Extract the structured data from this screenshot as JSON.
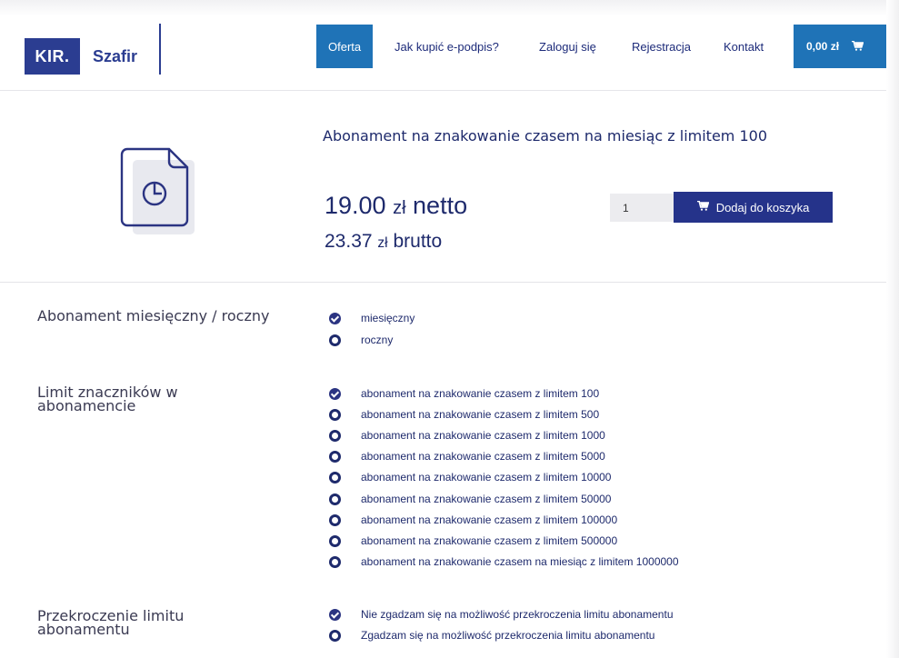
{
  "brand": {
    "logo_box": "KIR.",
    "logo_name": "Szafir"
  },
  "nav": {
    "items": [
      {
        "label": "Oferta",
        "active": true
      },
      {
        "label": "Jak kupić e-podpis?",
        "active": false
      },
      {
        "label": "Zaloguj się",
        "active": false
      },
      {
        "label": "Rejestracja",
        "active": false
      },
      {
        "label": "Kontakt",
        "active": false
      }
    ],
    "cart_total": "0,00 zł",
    "cart_icon": "shopping-cart-icon"
  },
  "product": {
    "title": "Abonament na znakowanie czasem na miesiąc z limitem 100",
    "icon": "document-clock-icon",
    "price_netto_value": "19.00",
    "price_netto_unit": "zł",
    "price_netto_label": "netto",
    "price_brutto_value": "23.37",
    "price_brutto_unit": "zł",
    "price_brutto_label": "brutto",
    "quantity": "1",
    "add_to_cart_label": "Dodaj do koszyka"
  },
  "groups": [
    {
      "label": "Abonament miesięczny / roczny",
      "options": [
        {
          "label": "miesięczny",
          "selected": true
        },
        {
          "label": "roczny",
          "selected": false
        }
      ]
    },
    {
      "label": "Limit znaczników w abonamencie",
      "options": [
        {
          "label": "abonament na znakowanie czasem z limitem 100",
          "selected": true
        },
        {
          "label": "abonament na znakowanie czasem z limitem 500",
          "selected": false
        },
        {
          "label": "abonament na znakowanie czasem z limitem 1000",
          "selected": false
        },
        {
          "label": "abonament na znakowanie czasem z limitem 5000",
          "selected": false
        },
        {
          "label": "abonament na znakowanie czasem z limitem 10000",
          "selected": false
        },
        {
          "label": "abonament na znakowanie czasem z limitem 50000",
          "selected": false
        },
        {
          "label": "abonament na znakowanie czasem z limitem 100000",
          "selected": false
        },
        {
          "label": "abonament na znakowanie czasem z limitem 500000",
          "selected": false
        },
        {
          "label": "abonament na znakowanie czasem na miesiąc z limitem 1000000",
          "selected": false
        }
      ]
    },
    {
      "label": "Przekroczenie limitu abonamentu",
      "options": [
        {
          "label": "Nie zgadzam się na możliwość przekroczenia limitu abonamentu",
          "selected": true
        },
        {
          "label": "Zgadzam się na możliwość przekroczenia limitu abonamentu",
          "selected": false
        }
      ]
    }
  ],
  "colors": {
    "brand_navy": "#2b3d91",
    "nav_blue": "#1f73b7",
    "button_navy": "#25338a"
  }
}
